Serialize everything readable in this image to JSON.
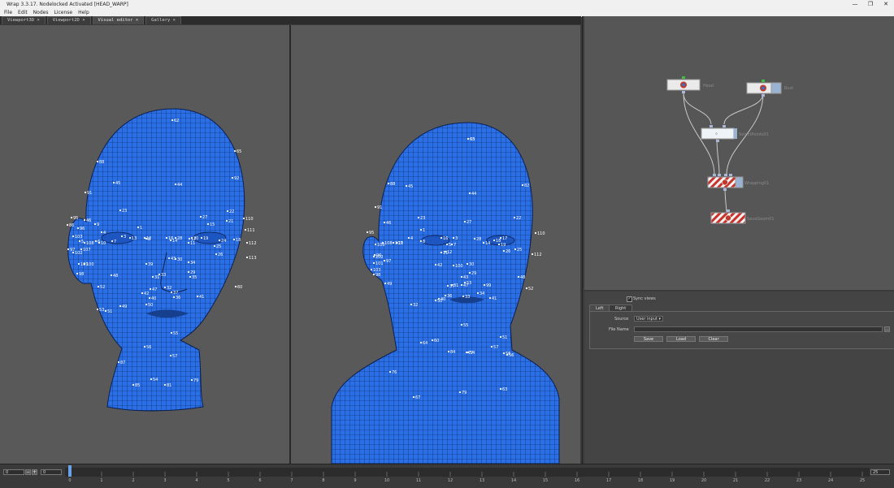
{
  "window": {
    "title": "Wrap 3.3.17. Nodelocked Activated [HEAD_WARP]",
    "controls": {
      "minimize": "—",
      "maximize": "❐",
      "close": "✕"
    }
  },
  "menu": [
    "File",
    "Edit",
    "Nodes",
    "License",
    "Help"
  ],
  "tabs": [
    {
      "label": "Viewport3D",
      "close": "×"
    },
    {
      "label": "Viewport2D",
      "close": "×"
    },
    {
      "label": "Visual editor",
      "close": "×"
    },
    {
      "label": "Gallery",
      "close": "×"
    }
  ],
  "viewports": {
    "left_points": [
      "62",
      "65",
      "88",
      "45",
      "44",
      "92",
      "91",
      "95",
      "46",
      "9",
      "23",
      "1",
      "27",
      "15",
      "21",
      "22",
      "110",
      "86",
      "96",
      "4",
      "3",
      "8",
      "16",
      "17",
      "111",
      "103",
      "5",
      "6",
      "7",
      "28",
      "20",
      "19",
      "24",
      "18",
      "112",
      "108",
      "10",
      "13",
      "12",
      "14",
      "11",
      "25",
      "97",
      "107",
      "102",
      "26",
      "113",
      "101",
      "100",
      "98",
      "39",
      "43",
      "30",
      "29",
      "34",
      "33",
      "31",
      "35",
      "32",
      "47",
      "52",
      "37",
      "36",
      "53",
      "48",
      "42",
      "40",
      "41",
      "60",
      "50",
      "49",
      "51",
      "55",
      "56",
      "87",
      "57",
      "54",
      "85",
      "81",
      "79"
    ],
    "right_points": [
      "63",
      "82",
      "88",
      "45",
      "44",
      "91",
      "46",
      "23",
      "27",
      "22",
      "110",
      "95",
      "106",
      "96",
      "4",
      "1",
      "8",
      "16",
      "3",
      "18",
      "17",
      "5",
      "7",
      "28",
      "14",
      "19",
      "25",
      "112",
      "108",
      "10",
      "107",
      "102",
      "11",
      "12",
      "26",
      "101",
      "97",
      "103",
      "100",
      "30",
      "29",
      "43",
      "98",
      "47",
      "42",
      "31",
      "34",
      "33",
      "32",
      "49",
      "99",
      "48",
      "37",
      "36",
      "53",
      "55",
      "41",
      "40",
      "64",
      "50",
      "52",
      "60",
      "51",
      "56",
      "58",
      "84",
      "77",
      "57",
      "54",
      "76",
      "67",
      "79",
      "63",
      "65"
    ]
  },
  "node_editor": {
    "nodes": [
      {
        "label": "Head"
      },
      {
        "label": "Bust"
      },
      {
        "label": "SelectPoints01"
      },
      {
        "label": "Wrapping01"
      },
      {
        "label": "SaveGeom01"
      }
    ]
  },
  "properties": {
    "sync_views_label": "Sync views",
    "sync_views_checked": "✓",
    "tabs": [
      "Left",
      "Right"
    ],
    "source_label": "Source",
    "source_value": "User input",
    "filename_label": "File Name",
    "filename_value": "",
    "browse_label": "…",
    "buttons": [
      "Save",
      "Load",
      "Clear"
    ]
  },
  "timeline": {
    "start": "0",
    "current": "0",
    "end": "25",
    "minus_label": "−",
    "plus_label": "+",
    "ticks": [
      "0",
      "1",
      "2",
      "3",
      "4",
      "5",
      "6",
      "7",
      "8",
      "9",
      "10",
      "11",
      "12",
      "13",
      "14",
      "15",
      "16",
      "17",
      "18",
      "19",
      "20",
      "21",
      "22",
      "23",
      "24",
      "25"
    ]
  },
  "colors": {
    "mesh": "#2a6fe6",
    "viewport_bg": "#595959",
    "node_editor_bg": "#565656",
    "wrap_node_stripes": "#c8322b"
  }
}
